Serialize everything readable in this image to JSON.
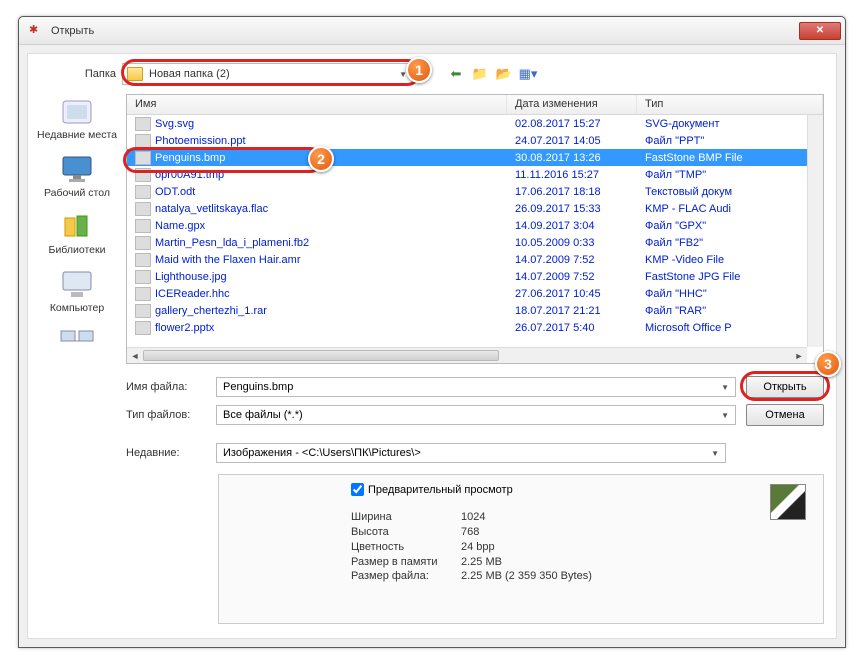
{
  "window": {
    "title": "Открыть"
  },
  "folder": {
    "label": "Папка",
    "current": "Новая папка (2)"
  },
  "columns": {
    "name": "Имя",
    "date": "Дата изменения",
    "type": "Тип"
  },
  "sidebar": [
    {
      "label": "Недавние места"
    },
    {
      "label": "Рабочий стол"
    },
    {
      "label": "Библиотеки"
    },
    {
      "label": "Компьютер"
    }
  ],
  "files": [
    {
      "name": "Svg.svg",
      "date": "02.08.2017 15:27",
      "type": "SVG-документ"
    },
    {
      "name": "Photoemission.ppt",
      "date": "24.07.2017 14:05",
      "type": "Файл \"PPT\""
    },
    {
      "name": "Penguins.bmp",
      "date": "30.08.2017 13:26",
      "type": "FastStone BMP File",
      "selected": true
    },
    {
      "name": "opr00A91.tmp",
      "date": "11.11.2016 15:27",
      "type": "Файл \"TMP\""
    },
    {
      "name": "ODT.odt",
      "date": "17.06.2017 18:18",
      "type": "Текстовый докум"
    },
    {
      "name": "natalya_vetlitskaya.flac",
      "date": "26.09.2017 15:33",
      "type": "KMP - FLAC Audi"
    },
    {
      "name": "Name.gpx",
      "date": "14.09.2017 3:04",
      "type": "Файл \"GPX\""
    },
    {
      "name": "Martin_Pesn_lda_i_plameni.fb2",
      "date": "10.05.2009 0:33",
      "type": "Файл \"FB2\""
    },
    {
      "name": "Maid with the Flaxen Hair.amr",
      "date": "14.07.2009 7:52",
      "type": "KMP -Video File"
    },
    {
      "name": "Lighthouse.jpg",
      "date": "14.07.2009 7:52",
      "type": "FastStone JPG File"
    },
    {
      "name": "ICEReader.hhc",
      "date": "27.06.2017 10:45",
      "type": "Файл \"HHC\""
    },
    {
      "name": "gallery_chertezhi_1.rar",
      "date": "18.07.2017 21:21",
      "type": "Файл \"RAR\""
    },
    {
      "name": "flower2.pptx",
      "date": "26.07.2017 5:40",
      "type": "Microsoft Office P"
    }
  ],
  "form": {
    "filename_label": "Имя файла:",
    "filename_value": "Penguins.bmp",
    "filetype_label": "Тип файлов:",
    "filetype_value": "Все файлы (*.*)",
    "recent_label": "Недавние:",
    "recent_value": "Изображения  -  <C:\\Users\\ПК\\Pictures\\>",
    "open": "Открыть",
    "cancel": "Отмена"
  },
  "preview": {
    "checkbox": "Предварительный просмотр",
    "meta": [
      {
        "k": "Ширина",
        "v": "1024"
      },
      {
        "k": "Высота",
        "v": "768"
      },
      {
        "k": "Цветность",
        "v": "24 bpp"
      },
      {
        "k": "Размер в памяти",
        "v": "2.25 MB"
      },
      {
        "k": "Размер файла:",
        "v": "2.25 MB (2 359 350 Bytes)"
      }
    ]
  },
  "badges": {
    "b1": "1",
    "b2": "2",
    "b3": "3"
  }
}
